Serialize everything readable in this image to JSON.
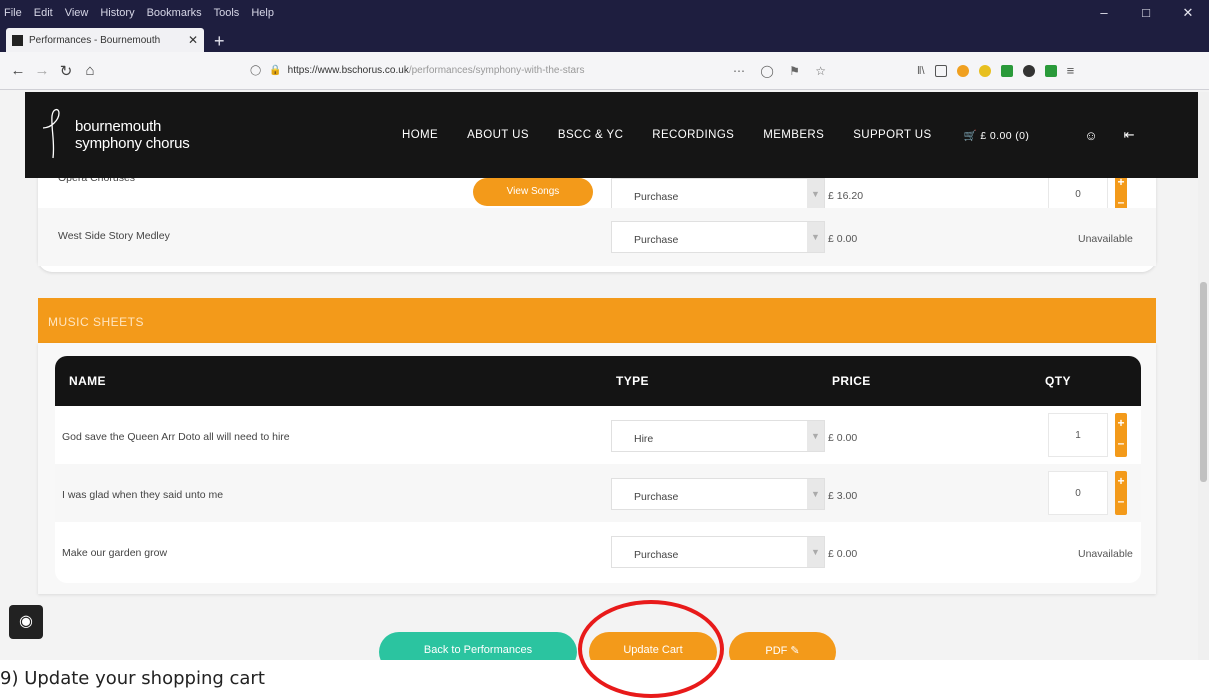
{
  "browser": {
    "menu": [
      "File",
      "Edit",
      "View",
      "History",
      "Bookmarks",
      "Tools",
      "Help"
    ],
    "tab_title": "Performances - Bournemouth",
    "url_host": "https://www.bschorus.co.uk",
    "url_path": "/performances/symphony-with-the-stars"
  },
  "site": {
    "logo_line1": "bournemouth",
    "logo_line2": "symphony chorus",
    "nav": [
      "HOME",
      "ABOUT US",
      "BSCC & YC",
      "RECORDINGS",
      "MEMBERS",
      "SUPPORT US"
    ],
    "cart": "£ 0.00 (0)"
  },
  "top_rows": [
    {
      "name": "Opera Choruses",
      "button": "View Songs",
      "type": "Purchase",
      "price": "£ 16.20",
      "qty": "0"
    },
    {
      "name": "West Side Story Medley",
      "type": "Purchase",
      "price": "£ 0.00",
      "status": "Unavailable"
    }
  ],
  "music_sheets": {
    "section_title": "MUSIC SHEETS",
    "headers": {
      "name": "NAME",
      "type": "TYPE",
      "price": "PRICE",
      "qty": "QTY"
    },
    "rows": [
      {
        "name": "God save the Queen Arr Doto all will need to hire",
        "type": "Hire",
        "price": "£ 0.00",
        "qty": "1"
      },
      {
        "name": "I was glad when they said unto me",
        "type": "Purchase",
        "price": "£ 3.00",
        "qty": "0"
      },
      {
        "name": "Make our garden grow",
        "type": "Purchase",
        "price": "£ 0.00",
        "status": "Unavailable"
      }
    ]
  },
  "actions": {
    "back": "Back to Performances",
    "update": "Update Cart",
    "pdf": "PDF"
  },
  "colors": {
    "accent": "#f39a1a",
    "teal": "#2bc4a0",
    "highlight": "#e81a1a"
  },
  "caption": "9) Update your shopping cart"
}
